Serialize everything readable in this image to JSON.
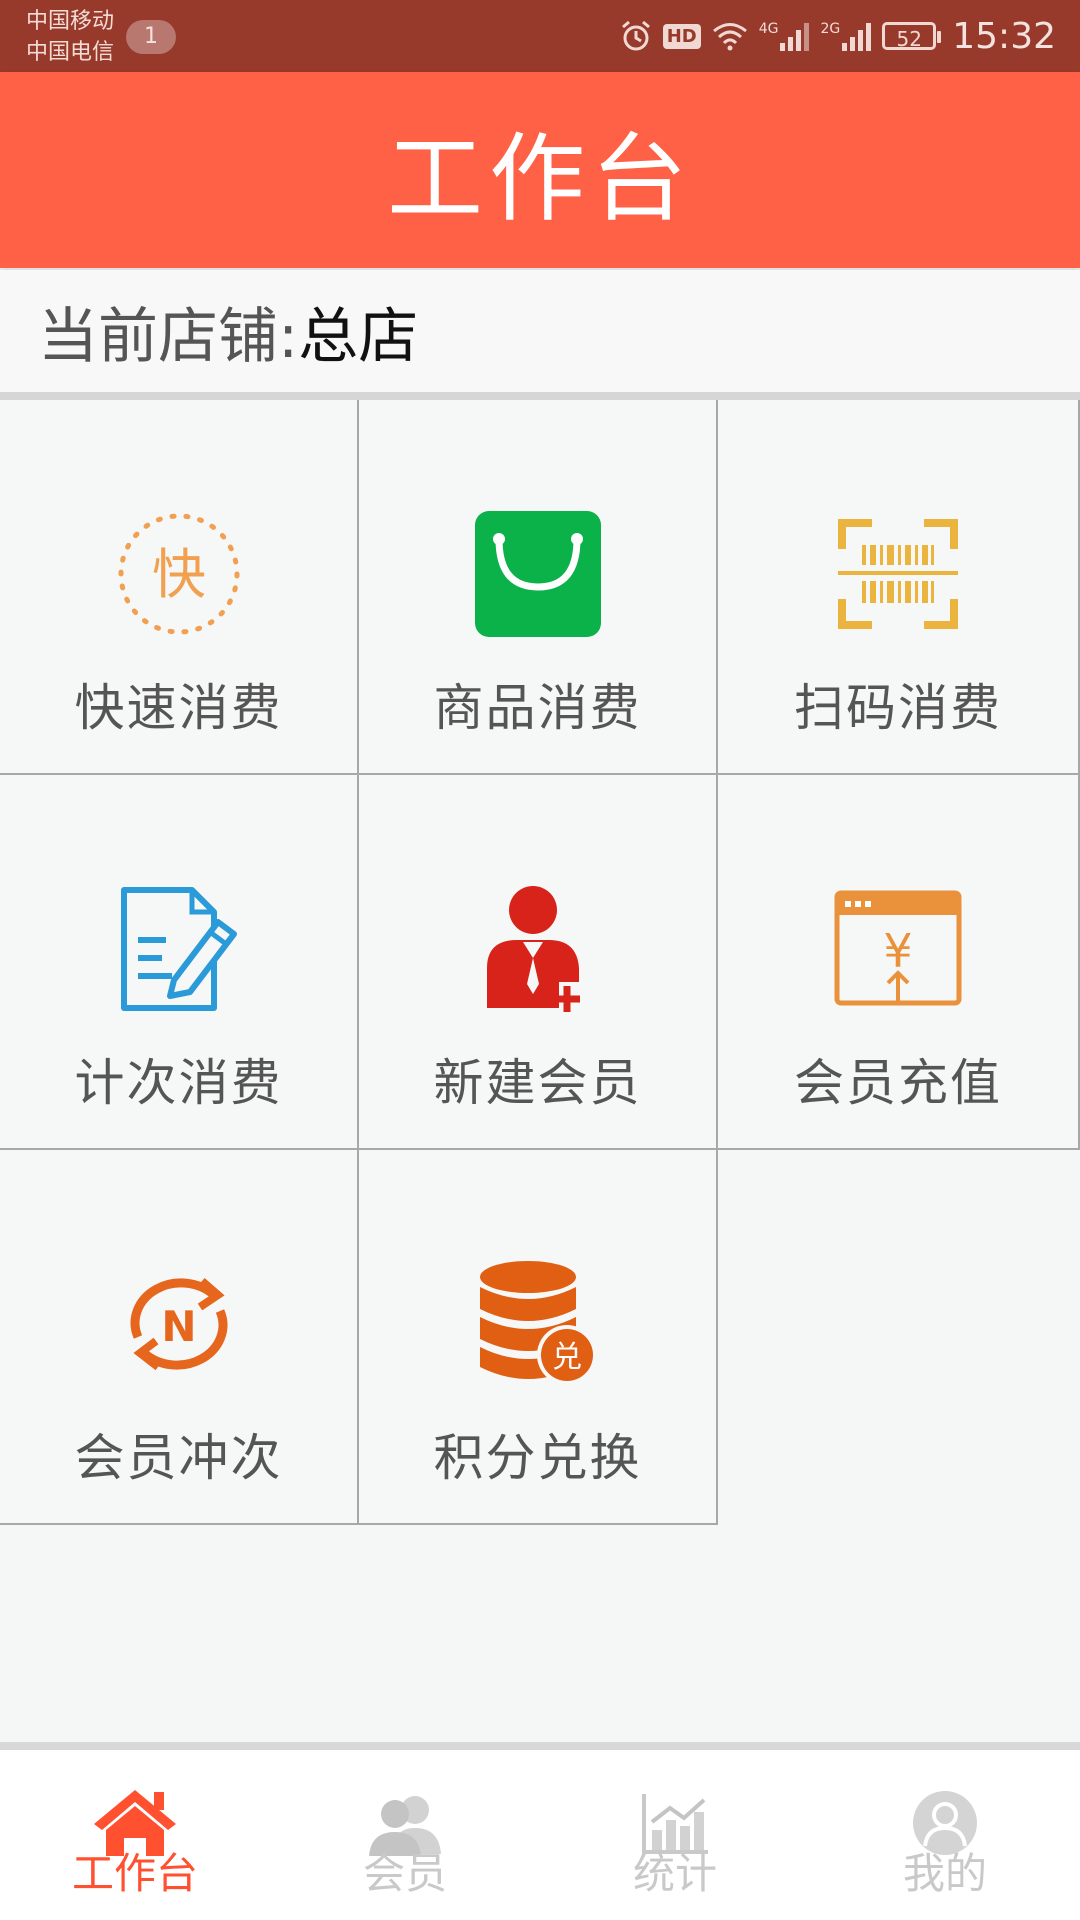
{
  "status_bar": {
    "carrier_1": "中国移动",
    "carrier_2": "中国电信",
    "notification_count": "1",
    "hd": "HD",
    "net_1": "4G",
    "net_2": "2G",
    "battery": "52",
    "time": "15:32"
  },
  "header": {
    "title": "工作台"
  },
  "store": {
    "label": "当前店铺: ",
    "value": "总店"
  },
  "grid": {
    "items": [
      {
        "label": "快速消费",
        "icon": "quick-consume-icon",
        "glyph": "快"
      },
      {
        "label": "商品消费",
        "icon": "shopping-bag-icon"
      },
      {
        "label": "扫码消费",
        "icon": "barcode-scan-icon"
      },
      {
        "label": "计次消费",
        "icon": "document-edit-icon"
      },
      {
        "label": "新建会员",
        "icon": "add-member-icon"
      },
      {
        "label": "会员充值",
        "icon": "recharge-window-icon",
        "glyph": "¥"
      },
      {
        "label": "会员冲次",
        "icon": "refresh-n-icon",
        "glyph": "N"
      },
      {
        "label": "积分兑换",
        "icon": "points-database-icon",
        "glyph": "兑"
      }
    ]
  },
  "bottom_nav": {
    "items": [
      {
        "label": "工作台",
        "icon": "home-icon",
        "active": true
      },
      {
        "label": "会员",
        "icon": "members-icon",
        "active": false
      },
      {
        "label": "统计",
        "icon": "statistics-icon",
        "active": false
      },
      {
        "label": "我的",
        "icon": "profile-icon",
        "active": false
      }
    ]
  },
  "colors": {
    "status_bar": "#97392b",
    "header": "#ff6146",
    "active_nav": "#ff5030",
    "inactive_nav": "#c9c9c9",
    "quick_orange": "#f0a050",
    "bag_green": "#0bb24a",
    "scan_yellow": "#eab43e",
    "doc_blue": "#2b9ad8",
    "member_red": "#d7231a",
    "recharge_orange": "#ea923b",
    "refresh_orange": "#e5661c",
    "db_orange": "#e05f12"
  }
}
